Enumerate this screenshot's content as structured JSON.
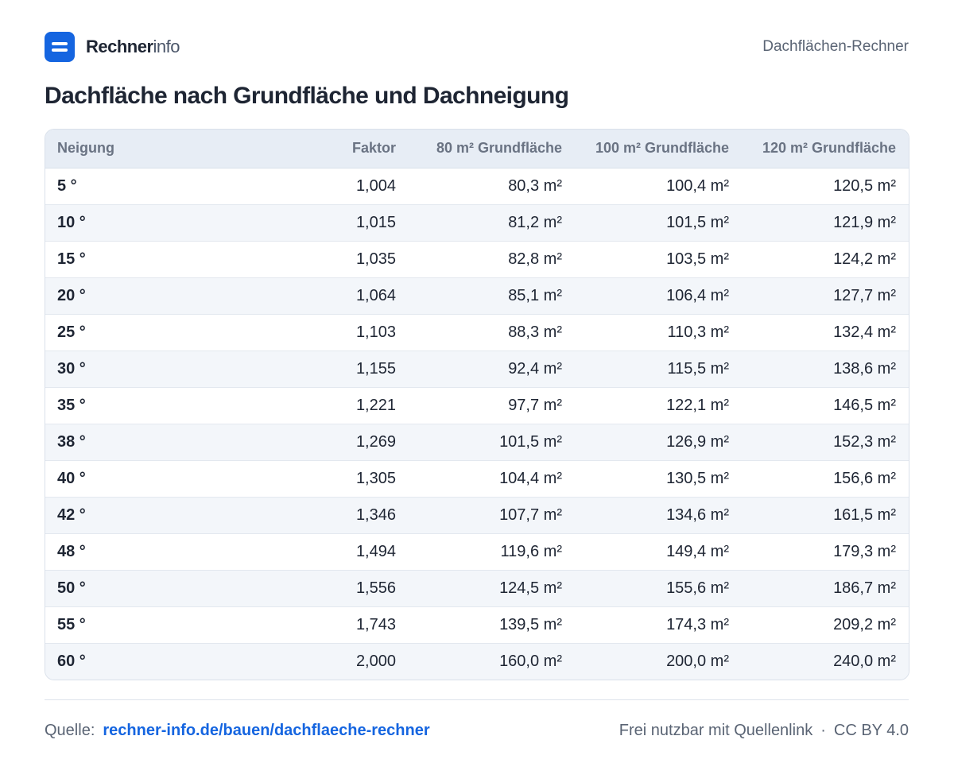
{
  "brand": {
    "name_bold": "Rechner",
    "name_light": "info"
  },
  "header": {
    "page_label": "Dachflächen-Rechner"
  },
  "title": "Dachfläche nach Grundfläche und Dachneigung",
  "table": {
    "columns": [
      "Neigung",
      "Faktor",
      "80 m² Grundfläche",
      "100 m² Grundfläche",
      "120 m² Grundfläche"
    ],
    "rows": [
      [
        "5 °",
        "1,004",
        "80,3 m²",
        "100,4 m²",
        "120,5 m²"
      ],
      [
        "10 °",
        "1,015",
        "81,2 m²",
        "101,5 m²",
        "121,9 m²"
      ],
      [
        "15 °",
        "1,035",
        "82,8 m²",
        "103,5 m²",
        "124,2 m²"
      ],
      [
        "20 °",
        "1,064",
        "85,1 m²",
        "106,4 m²",
        "127,7 m²"
      ],
      [
        "25 °",
        "1,103",
        "88,3 m²",
        "110,3 m²",
        "132,4 m²"
      ],
      [
        "30 °",
        "1,155",
        "92,4 m²",
        "115,5 m²",
        "138,6 m²"
      ],
      [
        "35 °",
        "1,221",
        "97,7 m²",
        "122,1 m²",
        "146,5 m²"
      ],
      [
        "38 °",
        "1,269",
        "101,5 m²",
        "126,9 m²",
        "152,3 m²"
      ],
      [
        "40 °",
        "1,305",
        "104,4 m²",
        "130,5 m²",
        "156,6 m²"
      ],
      [
        "42 °",
        "1,346",
        "107,7 m²",
        "134,6 m²",
        "161,5 m²"
      ],
      [
        "48 °",
        "1,494",
        "119,6 m²",
        "149,4 m²",
        "179,3 m²"
      ],
      [
        "50 °",
        "1,556",
        "124,5 m²",
        "155,6 m²",
        "186,7 m²"
      ],
      [
        "55 °",
        "1,743",
        "139,5 m²",
        "174,3 m²",
        "209,2 m²"
      ],
      [
        "60 °",
        "2,000",
        "160,0 m²",
        "200,0 m²",
        "240,0 m²"
      ]
    ]
  },
  "footer": {
    "source_label": "Quelle:",
    "source_link": "rechner-info.de/bauen/dachflaeche-rechner",
    "usage": "Frei nutzbar mit Quellenlink",
    "separator": "·",
    "license": "CC BY 4.0"
  },
  "colors": {
    "accent": "#1565e0",
    "header_bg": "#e7edf5",
    "stripe_bg": "#f3f6fa",
    "text": "#1e2533"
  },
  "icons": {
    "logo": "equals-logo-icon"
  }
}
